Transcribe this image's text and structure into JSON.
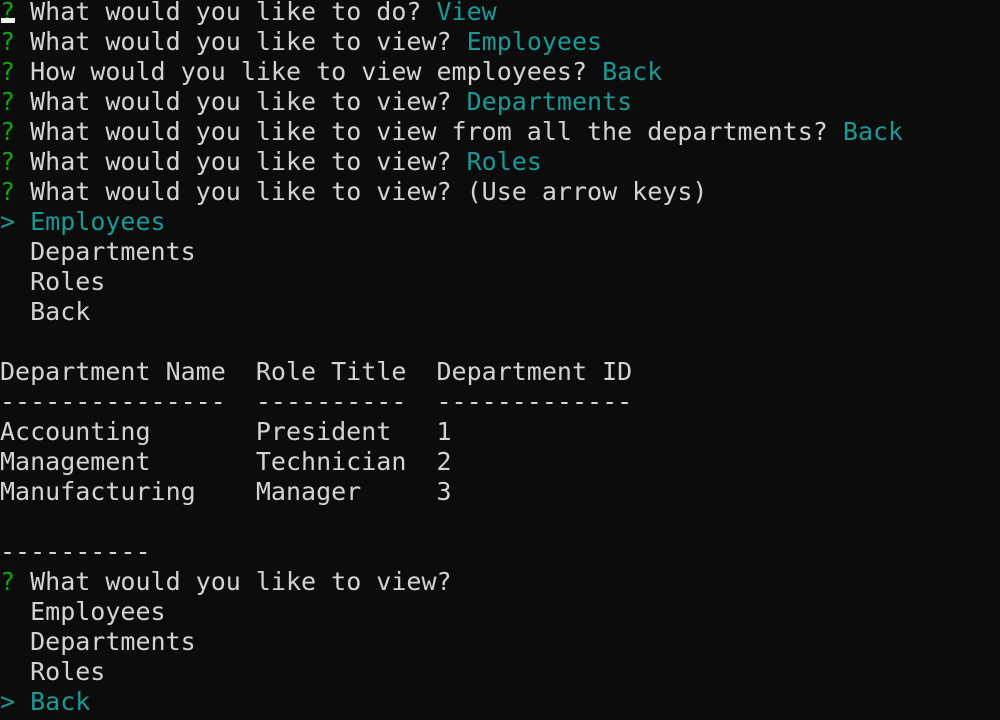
{
  "prompt_marker": "?",
  "pointer": ">",
  "history": [
    {
      "question": "What would you like to do?",
      "answer": "View"
    },
    {
      "question": "What would you like to view?",
      "answer": "Employees"
    },
    {
      "question": "How would you like to view employees?",
      "answer": "Back"
    },
    {
      "question": "What would you like to view?",
      "answer": "Departments"
    },
    {
      "question": "What would you like to view from all the departments?",
      "answer": "Back"
    },
    {
      "question": "What would you like to view?",
      "answer": "Roles"
    }
  ],
  "menu1": {
    "question": "What would you like to view?",
    "hint": "(Use arrow keys)",
    "options": [
      "Employees",
      "Departments",
      "Roles",
      "Back"
    ],
    "selected": 0
  },
  "table": {
    "headers": [
      "Department Name",
      "Role Title",
      "Department ID"
    ],
    "separators": [
      "---------------",
      "----------",
      "-------------"
    ],
    "rows": [
      [
        "Accounting",
        "President",
        "1"
      ],
      [
        "Management",
        "Technician",
        "2"
      ],
      [
        "Manufacturing",
        "Manager",
        "3"
      ]
    ],
    "footer": "----------"
  },
  "menu2": {
    "question": "What would you like to view?",
    "options": [
      "Employees",
      "Departments",
      "Roles",
      "Back"
    ],
    "selected": 3
  },
  "colors": {
    "marker": "#16a30f",
    "answer": "#1a9a96",
    "text": "#d4d4d4",
    "background": "#0c0c0c"
  }
}
